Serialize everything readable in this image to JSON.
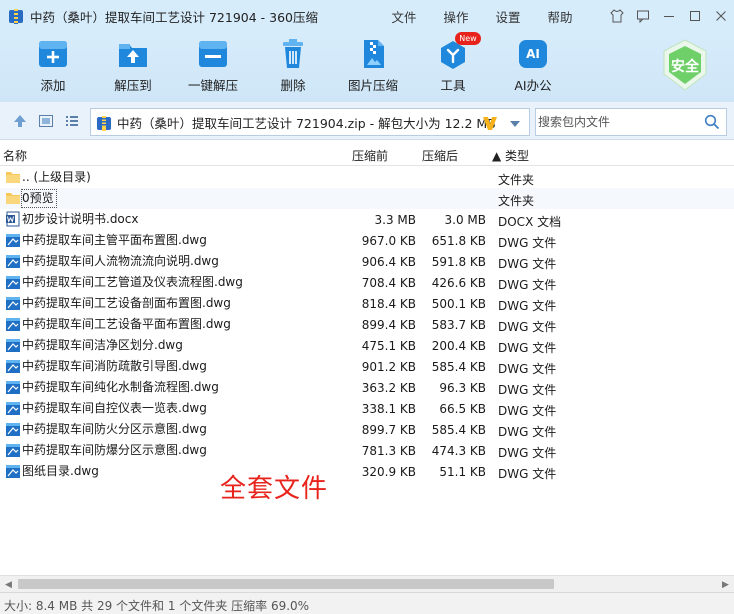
{
  "window": {
    "title": "中药（桑叶）提取车间工艺设计 721904 - 360压缩",
    "menus": [
      "文件",
      "操作",
      "设置",
      "帮助"
    ]
  },
  "toolbar": {
    "buttons": [
      {
        "label": "添加",
        "icon": "add-archive-icon"
      },
      {
        "label": "解压到",
        "icon": "extract-to-icon"
      },
      {
        "label": "一键解压",
        "icon": "one-click-extract-icon"
      },
      {
        "label": "删除",
        "icon": "trash-icon"
      },
      {
        "label": "图片压缩",
        "icon": "image-compress-icon"
      },
      {
        "label": "工具",
        "icon": "tools-icon",
        "badge": "New"
      },
      {
        "label": "AI办公",
        "icon": "ai-office-icon",
        "glyph": "AI"
      }
    ],
    "security_badge": "安全"
  },
  "address": {
    "path": "中药（桑叶）提取车间工艺设计 721904.zip - 解包大小为 12.2 MB",
    "search_placeholder": "搜索包内文件"
  },
  "columns": {
    "name": "名称",
    "packed": "压缩前",
    "unpacked": "压缩后",
    "type": "▲ 类型"
  },
  "files": [
    {
      "name": ".. (上级目录)",
      "packed": "",
      "unpacked": "",
      "type": "文件夹",
      "kind": "folder"
    },
    {
      "name": "0预览",
      "packed": "",
      "unpacked": "",
      "type": "文件夹",
      "kind": "folder"
    },
    {
      "name": "初步设计说明书.docx",
      "packed": "3.3 MB",
      "unpacked": "3.0 MB",
      "type": "DOCX 文档",
      "kind": "docx"
    },
    {
      "name": "中药提取车间主管平面布置图.dwg",
      "packed": "967.0 KB",
      "unpacked": "651.8 KB",
      "type": "DWG 文件",
      "kind": "dwg"
    },
    {
      "name": "中药提取车间人流物流流向说明.dwg",
      "packed": "906.4 KB",
      "unpacked": "591.8 KB",
      "type": "DWG 文件",
      "kind": "dwg"
    },
    {
      "name": "中药提取车间工艺管道及仪表流程图.dwg",
      "packed": "708.4 KB",
      "unpacked": "426.6 KB",
      "type": "DWG 文件",
      "kind": "dwg"
    },
    {
      "name": "中药提取车间工艺设备剖面布置图.dwg",
      "packed": "818.4 KB",
      "unpacked": "500.1 KB",
      "type": "DWG 文件",
      "kind": "dwg"
    },
    {
      "name": "中药提取车间工艺设备平面布置图.dwg",
      "packed": "899.4 KB",
      "unpacked": "583.7 KB",
      "type": "DWG 文件",
      "kind": "dwg"
    },
    {
      "name": "中药提取车间洁净区划分.dwg",
      "packed": "475.1 KB",
      "unpacked": "200.4 KB",
      "type": "DWG 文件",
      "kind": "dwg"
    },
    {
      "name": "中药提取车间消防疏散引导图.dwg",
      "packed": "901.2 KB",
      "unpacked": "585.4 KB",
      "type": "DWG 文件",
      "kind": "dwg"
    },
    {
      "name": "中药提取车间纯化水制备流程图.dwg",
      "packed": "363.2 KB",
      "unpacked": "96.3 KB",
      "type": "DWG 文件",
      "kind": "dwg"
    },
    {
      "name": "中药提取车间自控仪表一览表.dwg",
      "packed": "338.1 KB",
      "unpacked": "66.5 KB",
      "type": "DWG 文件",
      "kind": "dwg"
    },
    {
      "name": "中药提取车间防火分区示意图.dwg",
      "packed": "899.7 KB",
      "unpacked": "585.4 KB",
      "type": "DWG 文件",
      "kind": "dwg"
    },
    {
      "name": "中药提取车间防爆分区示意图.dwg",
      "packed": "781.3 KB",
      "unpacked": "474.3 KB",
      "type": "DWG 文件",
      "kind": "dwg"
    },
    {
      "name": "图纸目录.dwg",
      "packed": "320.9 KB",
      "unpacked": "51.1 KB",
      "type": "DWG 文件",
      "kind": "dwg"
    }
  ],
  "overlay_text": "全套文件",
  "status": "大小: 8.4 MB 共 29 个文件和 1 个文件夹 压缩率 69.0%",
  "colors": {
    "accent": "#1f88dc",
    "titlebar": "#d7ecfb",
    "folder": "#f7c85a",
    "overlay": "#e8231c",
    "security": "#6fd06a"
  }
}
